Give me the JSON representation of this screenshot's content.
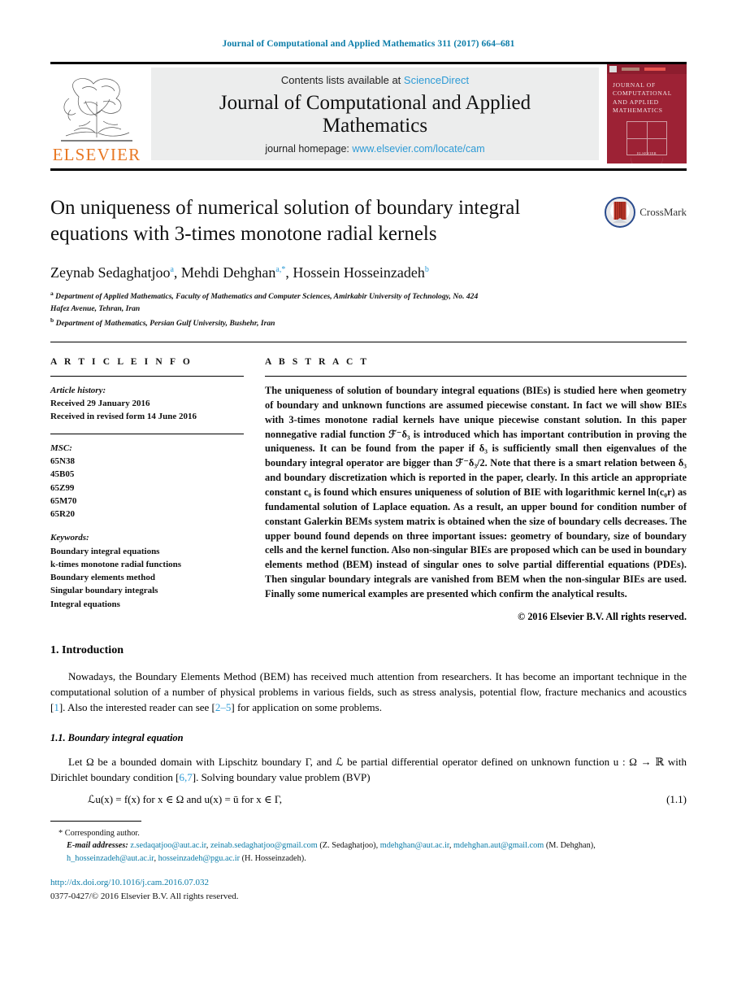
{
  "running_head": "Journal of Computational and Applied Mathematics 311 (2017) 664–681",
  "masthead": {
    "publisher_wordmark": "ELSEVIER",
    "contents_prefix": "Contents lists available at ",
    "contents_link": "ScienceDirect",
    "journal_title_line1": "Journal of Computational and Applied",
    "journal_title_line2": "Mathematics",
    "homepage_prefix": "journal homepage: ",
    "homepage_link": "www.elsevier.com/locate/cam",
    "cover": {
      "title": "JOURNAL OF COMPUTATIONAL AND APPLIED MATHEMATICS",
      "footer": "ELSEVIER"
    }
  },
  "article": {
    "title": "On uniqueness of numerical solution of boundary integral equations with 3-times monotone radial kernels",
    "crossmark_label": "CrossMark",
    "authors": "Zeynab Sedaghatjoo ª, Mehdi Dehghan ª,*, Hossein Hosseinzadeh ᵇ",
    "authors_parts": [
      {
        "name": "Zeynab Sedaghatjoo",
        "marks": "a"
      },
      {
        "name": "Mehdi Dehghan",
        "marks": "a,*"
      },
      {
        "name": "Hossein Hosseinzadeh",
        "marks": "b"
      }
    ],
    "affiliations": [
      {
        "mark": "a",
        "line1": "Department of Applied Mathematics, Faculty of Mathematics and Computer Sciences, Amirkabir University of Technology, No. 424",
        "line2": "Hafez Avenue, Tehran, Iran"
      },
      {
        "mark": "b",
        "line1": "Department of Mathematics, Persian Gulf University, Bushehr, Iran",
        "line2": ""
      }
    ]
  },
  "article_info": {
    "heading": "A R T I C L E    I N F O",
    "history_label": "Article history:",
    "history": [
      "Received 29 January 2016",
      "Received in revised form 14 June 2016"
    ],
    "msc_label": "MSC:",
    "msc": [
      "65N38",
      "45B05",
      "65Z99",
      "65M70",
      "65R20"
    ],
    "keywords_label": "Keywords:",
    "keywords": [
      "Boundary integral equations",
      "k-times monotone radial functions",
      "Boundary elements method",
      "Singular boundary integrals",
      "Integral equations"
    ]
  },
  "abstract": {
    "heading": "A B S T R A C T",
    "text": "The uniqueness of solution of boundary integral equations (BIEs) is studied here when geometry of boundary and unknown functions are assumed piecewise constant. In fact we will show BIEs with 3-times monotone radial kernels have unique piecewise constant solution. In this paper nonnegative radial function ℱ⁻δ₃ is introduced which has important contribution in proving the uniqueness. It can be found from the paper if δ₃ is sufficiently small then eigenvalues of the boundary integral operator are bigger than ℱ⁻δ₃/2. Note that there is a smart relation between δ₃ and boundary discretization which is reported in the paper, clearly. In this article an appropriate constant c₀ is found which ensures uniqueness of solution of BIE with logarithmic kernel ln(c₀r) as fundamental solution of Laplace equation. As a result, an upper bound for condition number of constant Galerkin BEMs system matrix is obtained when the size of boundary cells decreases. The upper bound found depends on three important issues: geometry of boundary, size of boundary cells and the kernel function. Also non-singular BIEs are proposed which can be used in boundary elements method (BEM) instead of singular ones to solve partial differential equations (PDEs). Then singular boundary integrals are vanished from BEM when the non-singular BIEs are used. Finally some numerical examples are presented which confirm the analytical results.",
    "copyright": "© 2016 Elsevier B.V. All rights reserved."
  },
  "body": {
    "section1_title": "1. Introduction",
    "section1_para1": "Nowadays, the Boundary Elements Method (BEM) has received much attention from researchers. It has become an important technique in the computational solution of a number of physical problems in various fields, such as stress analysis, potential flow, fracture mechanics and acoustics [1]. Also the interested reader can see [2–5] for application on some problems.",
    "subsection11_title": "1.1. Boundary integral equation",
    "subsection11_para1": "Let Ω be a bounded domain with Lipschitz boundary Γ, and ℒ be partial differential operator defined on unknown function u : Ω → ℝ with Dirichlet boundary condition [6,7]. Solving boundary value problem (BVP)",
    "equation_1_1": "ℒu(x) = f(x)   for x ∈ Ω   and   u(x) = ū   for x ∈ Γ,",
    "equation_1_1_number": "(1.1)",
    "references_inline": [
      "1",
      "2–5",
      "6,7"
    ]
  },
  "footnotes": {
    "corresponding": "* Corresponding author.",
    "email_label": "E-mail addresses:",
    "emails_text": "z.sedaqatjoo@aut.ac.ir, zeinab.sedaghatjoo@gmail.com (Z. Sedaghatjoo), mdehghan@aut.ac.ir, mdehghan.aut@gmail.com (M. Dehghan), h_hosseinzadeh@aut.ac.ir, hosseinzadeh@pgu.ac.ir (H. Hosseinzadeh).",
    "emails": [
      {
        "address": "z.sedaqatjoo@aut.ac.ir",
        "owner": ""
      },
      {
        "address": "zeinab.sedaghatjoo@gmail.com",
        "owner": "(Z. Sedaghatjoo),"
      },
      {
        "address": "mdehghan@aut.ac.ir",
        "owner": ""
      },
      {
        "address": "mdehghan.aut@gmail.com",
        "owner": "(M. Dehghan),"
      },
      {
        "address": "h_hosseinzadeh@aut.ac.ir",
        "owner": ""
      },
      {
        "address": "hosseinzadeh@pgu.ac.ir",
        "owner": "(H. Hosseinzadeh)."
      }
    ],
    "doi": "http://dx.doi.org/10.1016/j.cam.2016.07.032",
    "issn_line": "0377-0427/© 2016 Elsevier B.V. All rights reserved."
  },
  "colors": {
    "link_blue": "#2e9bd6",
    "head_blue": "#0b7ca8",
    "elsevier_orange": "#E87722",
    "cover_maroon": "#9d2235"
  }
}
